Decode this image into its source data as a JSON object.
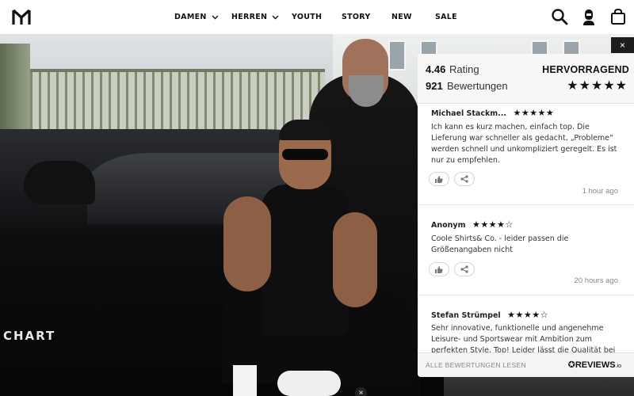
{
  "nav": {
    "items": [
      {
        "label": "DAMEN"
      },
      {
        "label": "HERREN"
      },
      {
        "label": "YOUTH"
      },
      {
        "label": "STORY"
      },
      {
        "label": "NEW"
      },
      {
        "label": "SALE"
      }
    ]
  },
  "hero": {
    "car_lettering": "CHART"
  },
  "widget": {
    "close_label": "×",
    "rating_value": "4.46",
    "rating_label": "Rating",
    "count_value": "921",
    "count_label": "Bewertungen",
    "verdict": "HERVORRAGEND",
    "verdict_stars": "★★★★★",
    "reviews": [
      {
        "author": "Michael Stackm...",
        "stars": "★★★★★",
        "text": "Ich kann es kurz machen, einfach top. Die Lieferung war schneller als gedacht, „Probleme“ werden schnell und unkompliziert geregelt. Es ist nur zu empfehlen.",
        "time": "1 hour ago"
      },
      {
        "author": "Anonym",
        "stars": "★★★★☆",
        "text": "Coole Shirts& Co. - leider passen die Größenangaben nicht",
        "time": "20 hours ago"
      },
      {
        "author": "Stefan Strümpel",
        "stars": "★★★★☆",
        "text": "Sehr innovative, funktionelle und angenehme Leisure- und Sportswear mit Ambition zum perfekten Style. Top! Leider lässt die Qualität bei",
        "time": ""
      }
    ],
    "footer_link": "ALLE BEWERTUNGEN LESEN",
    "footer_brand": "REVIEWS",
    "footer_brand_suffix": ".io"
  },
  "bottom_close_label": "×"
}
